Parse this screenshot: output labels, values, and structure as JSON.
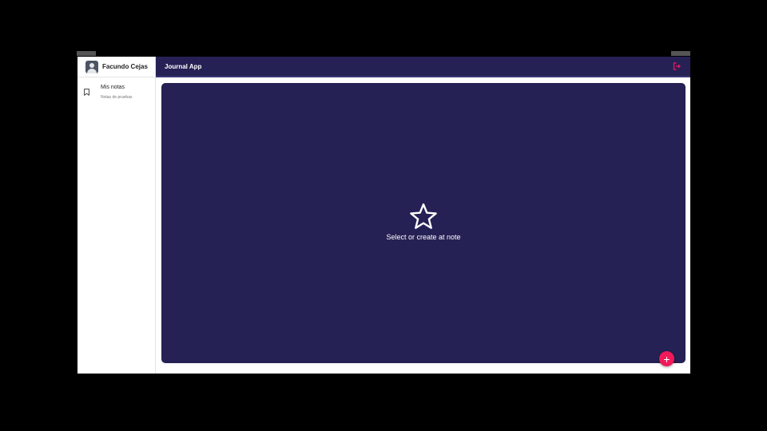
{
  "sidebar": {
    "user_name": "Facundo Cejas",
    "avatar_icon": "account-box-icon",
    "notes": [
      {
        "title": "Mis notas",
        "subtitle": "Notas de pruebas",
        "icon": "bookmark-icon"
      }
    ]
  },
  "appbar": {
    "title": "Journal App",
    "logout_icon": "logout-icon",
    "logout_color": "#f0195a"
  },
  "main": {
    "empty_icon": "star-outline-icon",
    "empty_text": "Select or create at note"
  },
  "fab": {
    "label": "+",
    "color": "#f0195a"
  },
  "colors": {
    "primary": "#262154",
    "accent": "#f0195a"
  }
}
